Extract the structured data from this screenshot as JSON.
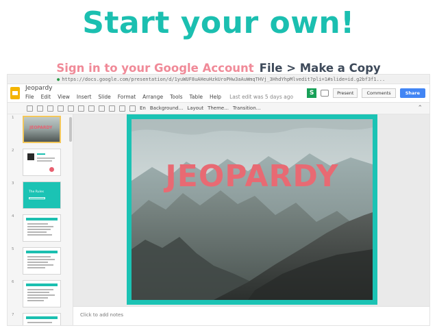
{
  "headline": "Start your own!",
  "subline": {
    "signin": "Sign in to your Google Account",
    "copy": "File > Make a Copy"
  },
  "browser": {
    "url": "https://docs.google.com/presentation/d/1yuWUF8uAHeuHzkUroPHw3aAuWmqTHVj_3HhdYhpMlvedit?pli=1#slide=id.g2bf3f1..."
  },
  "doc": {
    "title": "Jeopardy",
    "menu": [
      "File",
      "Edit",
      "View",
      "Insert",
      "Slide",
      "Format",
      "Arrange",
      "Tools",
      "Table",
      "Help"
    ],
    "last_edit": "Last edit was 5 days ago",
    "buttons": {
      "present": "Present",
      "comments": "Comments",
      "share": "Share"
    }
  },
  "toolbar": {
    "zoom": "En",
    "background": "Background...",
    "layout": "Layout",
    "theme": "Theme...",
    "transition": "Transition..."
  },
  "filmstrip": {
    "numbers": [
      "1",
      "2",
      "3",
      "4",
      "5",
      "6",
      "7"
    ],
    "thumb1_title": "JEOPARDY",
    "thumb3_text": "The Rules"
  },
  "slide": {
    "title": "JEOPARDY"
  },
  "notes": {
    "placeholder": "Click to add notes"
  },
  "colors": {
    "teal": "#1bbfb0",
    "pink": "#f08a98",
    "dark": "#3e4a5a",
    "title_pink": "#e86a73"
  }
}
